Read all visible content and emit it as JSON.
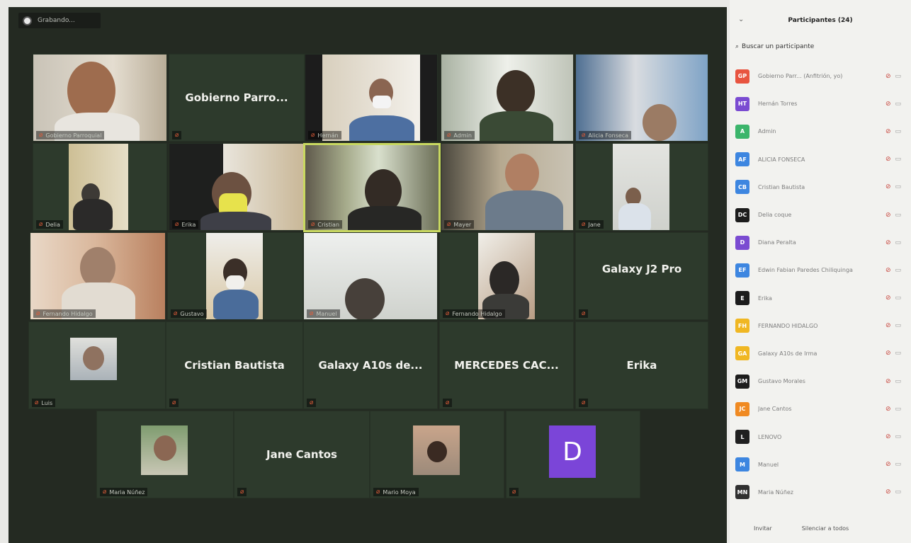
{
  "recording_label": "Grabando...",
  "tiles_names": [
    "Gobierno Parroquial",
    "Gobierno Parro...",
    "Hernán",
    "Admin",
    "Alicia Fonseca",
    "Delia",
    "Erika",
    "Cristian",
    "Mayer",
    "Jane",
    "Fernando Hidalgo",
    "Gustavo",
    "Manuel",
    "Fernando Hidalgo",
    "Galaxy J2 Pro",
    "Luis",
    "Cristian Bautista",
    "Galaxy A10s de...",
    "MERCEDES CAC...",
    "Erika",
    "Maria Núñez",
    "Jane Cantos",
    "Mario Moya",
    "D"
  ],
  "panel": {
    "title": "Participantes (24)",
    "search_placeholder": "Buscar un participante",
    "participants": [
      {
        "initials": "GP",
        "color": "#e8543f",
        "name": "Gobierno Parr... (Anfitrión, yo)"
      },
      {
        "initials": "HT",
        "color": "#7a4bd1",
        "name": "Hernán Torres"
      },
      {
        "initials": "A",
        "color": "#3bb56b",
        "name": "Admin"
      },
      {
        "initials": "AF",
        "color": "#3d86e0",
        "name": "ALICIA FONSECA"
      },
      {
        "initials": "CB",
        "color": "#3d86e0",
        "name": "Cristian Bautista"
      },
      {
        "initials": "DC",
        "color": "#1c1c1c",
        "name": "Delia coque"
      },
      {
        "initials": "D",
        "color": "#7a4bd1",
        "name": "Diana Peralta"
      },
      {
        "initials": "EF",
        "color": "#3d86e0",
        "name": "Edwin Fabian Paredes Chiliquinga"
      },
      {
        "initials": "E",
        "color": "#1c1c1c",
        "name": "Erika"
      },
      {
        "initials": "FH",
        "color": "#f0b722",
        "name": "FERNANDO HIDALGO"
      },
      {
        "initials": "GA",
        "color": "#f0b722",
        "name": "Galaxy A10s de Irma"
      },
      {
        "initials": "GM",
        "color": "#1c1c1c",
        "name": "Gustavo Morales"
      },
      {
        "initials": "JC",
        "color": "#f08a22",
        "name": "Jane Cantos"
      },
      {
        "initials": "L",
        "color": "#202020",
        "name": "LENOVO"
      },
      {
        "initials": "M",
        "color": "#3d86e0",
        "name": "Manuel"
      },
      {
        "initials": "MN",
        "color": "#303030",
        "name": "Maria Núñez"
      }
    ],
    "invite_label": "Invitar",
    "mute_all_label": "Silenciar a todos"
  }
}
